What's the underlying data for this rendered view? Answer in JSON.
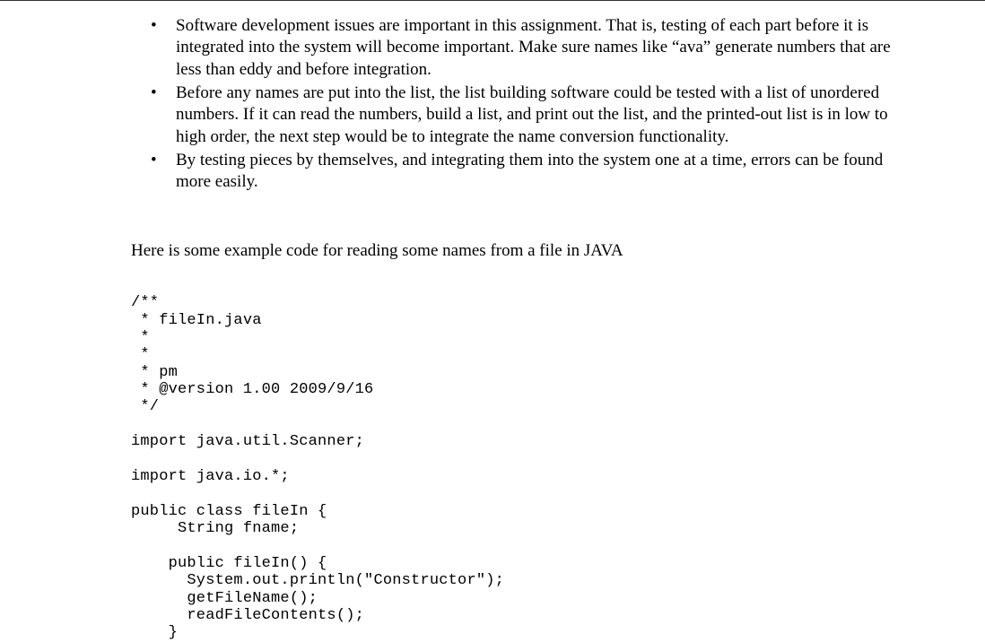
{
  "bullets": [
    "Software development issues are important in this assignment.  That is, testing of each part before it is integrated into the system will become important.  Make sure names like “ava” generate numbers that are less than eddy and before integration.",
    "Before any names are put into the list, the list building software could be tested with a list of unordered numbers.  If it can read the numbers, build a list, and print out the list, and the printed-out list is in low to high order, the next step would be to integrate the name conversion functionality.",
    "By testing pieces by themselves, and integrating them into the system one at a time, errors can be found more easily."
  ],
  "intro": "Here is some example code for reading some names from a file in JAVA",
  "code": "/**\n * fileIn.java\n *\n *\n * pm\n * @version 1.00 2009/9/16\n */\n\nimport java.util.Scanner;\n\nimport java.io.*;\n\npublic class fileIn {\n     String fname;\n\n    public fileIn() {\n      System.out.println(\"Constructor\");\n      getFileName();\n      readFileContents();\n    }"
}
